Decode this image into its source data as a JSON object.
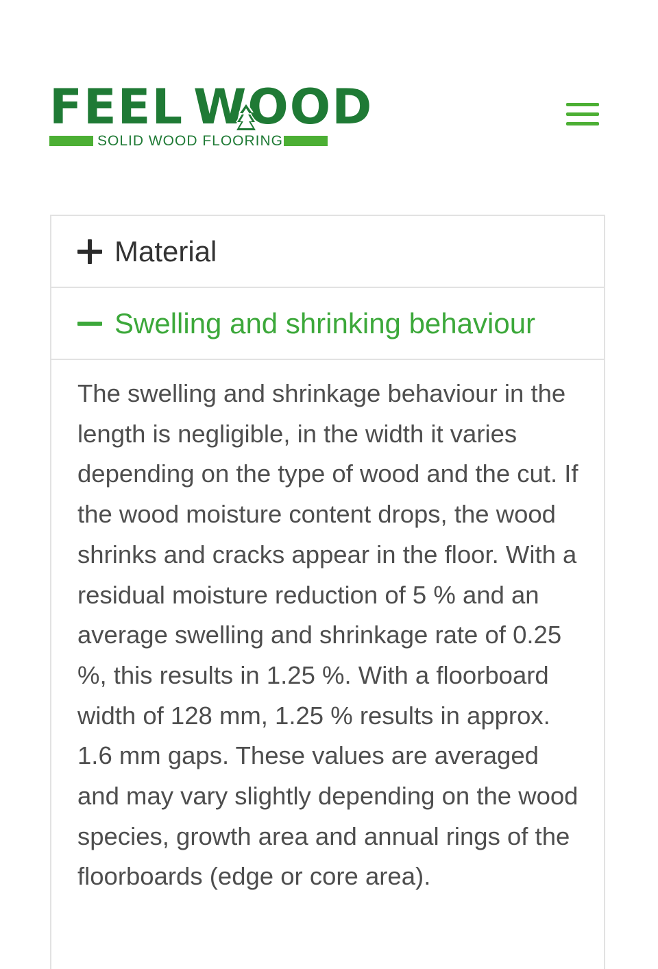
{
  "header": {
    "logo": {
      "word_left": "FEEL",
      "word_right": "WOOD",
      "tagline": "SOLID WOOD FLOORING"
    },
    "menu_icon": "hamburger-menu-icon"
  },
  "accordion": {
    "items": [
      {
        "icon": "plus-icon",
        "title": "Material",
        "expanded": false
      },
      {
        "icon": "minus-icon",
        "title": "Swelling and shrinking behaviour",
        "expanded": true,
        "body": "The swelling and shrinkage behaviour in the length is negligible, in the width it varies depending on the type of wood and the cut. If the wood moisture content drops, the wood shrinks and cracks appear in the floor. With a residual moisture reduction of 5 % and an average swelling and shrinkage rate of 0.25 %, this results in 1.25 %. With a floorboard width of 128 mm, 1.25 % results in approx. 1.6 mm gaps. These values are averaged and may vary slightly depending on the wood species, growth area and annual rings of the floorboards (edge or core area)."
      }
    ]
  },
  "colors": {
    "brand_dark_green": "#1f7a35",
    "brand_light_green": "#4caf34",
    "active_green": "#3ca83a",
    "border_gray": "#e2e2e2",
    "text_gray": "#4e4e4e"
  }
}
